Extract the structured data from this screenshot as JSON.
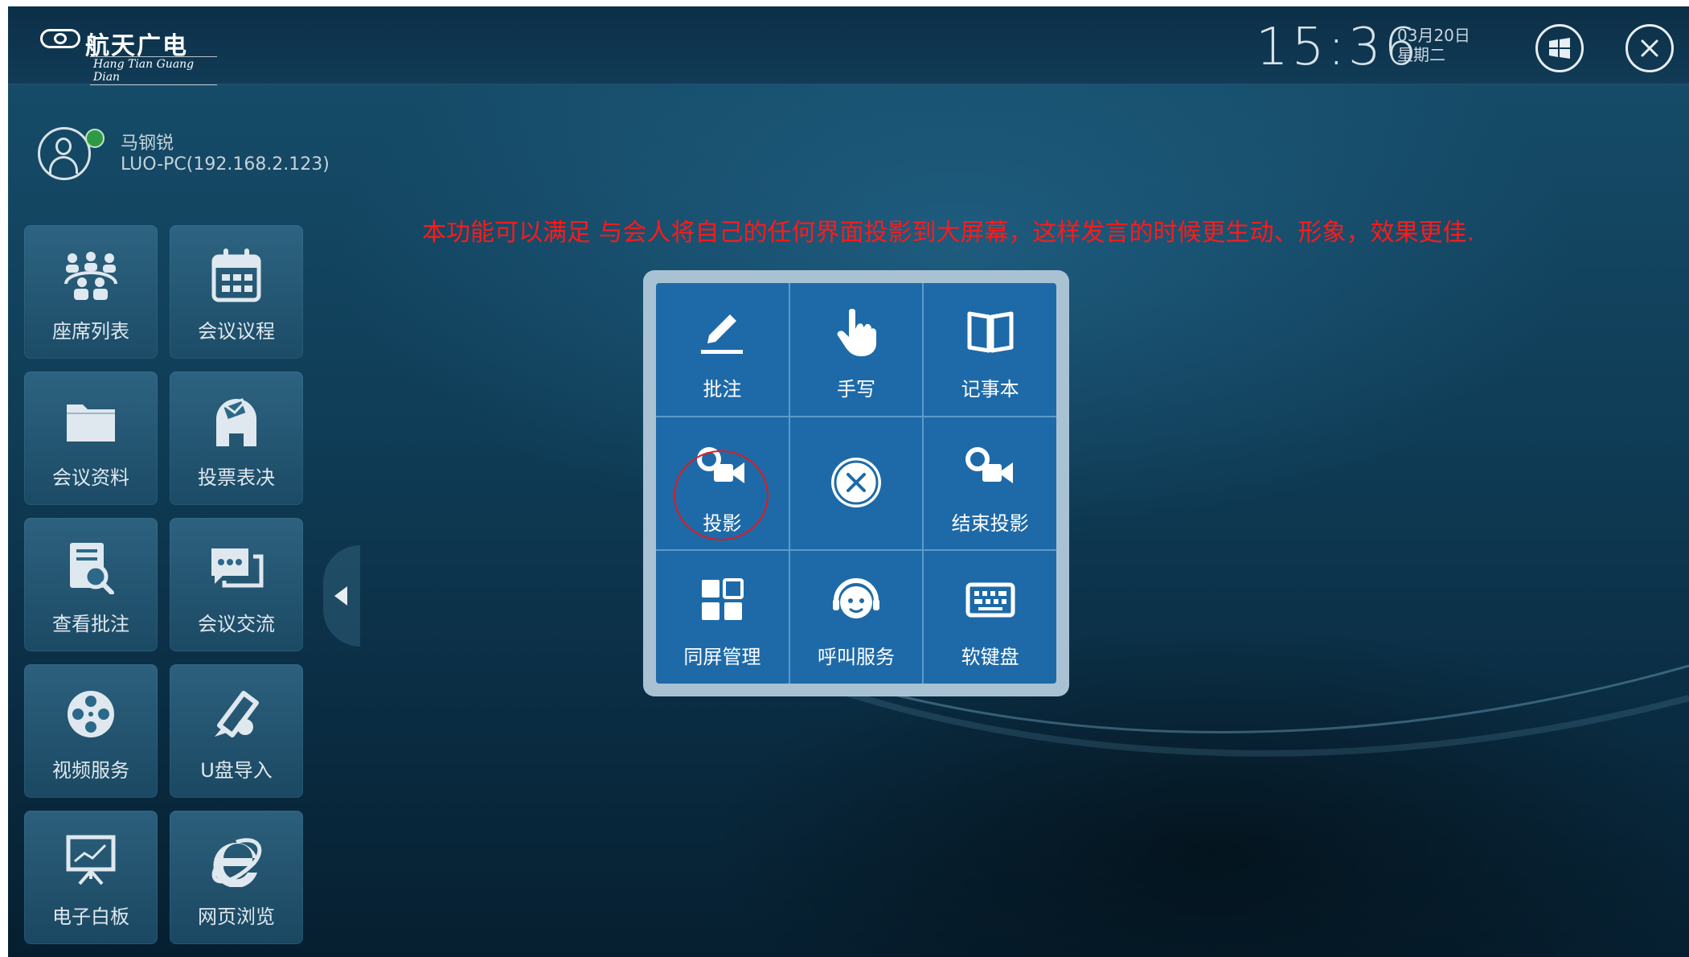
{
  "header": {
    "brand": "航天广电",
    "brand_sub": "Hang Tian Guang Dian",
    "time": "15:36",
    "date": "03月20日",
    "weekday": "星期二"
  },
  "user": {
    "name": "马钢锐",
    "host": "LUO-PC(192.168.2.123)"
  },
  "annotation": "本功能可以满足 与会人将自己的任何界面投影到大屏幕，这样发言的时候更生动、形象，效果更佳.",
  "sidebar": {
    "items": [
      {
        "label": "座席列表",
        "icon": "seat-list-icon"
      },
      {
        "label": "会议议程",
        "icon": "calendar-icon"
      },
      {
        "label": "会议资料",
        "icon": "folder-icon"
      },
      {
        "label": "投票表决",
        "icon": "vote-icon"
      },
      {
        "label": "查看批注",
        "icon": "view-annotation-icon"
      },
      {
        "label": "会议交流",
        "icon": "chat-icon"
      },
      {
        "label": "视频服务",
        "icon": "film-reel-icon"
      },
      {
        "label": "U盘导入",
        "icon": "usb-import-icon"
      },
      {
        "label": "电子白板",
        "icon": "whiteboard-icon"
      },
      {
        "label": "网页浏览",
        "icon": "ie-icon"
      }
    ]
  },
  "popup": {
    "items": [
      {
        "label": "批注",
        "icon": "pen-icon"
      },
      {
        "label": "手写",
        "icon": "hand-pointer-icon"
      },
      {
        "label": "记事本",
        "icon": "book-icon"
      },
      {
        "label": "投影",
        "icon": "camera-icon"
      },
      {
        "label": "",
        "icon": "close-circle-icon"
      },
      {
        "label": "结束投影",
        "icon": "camera-icon"
      },
      {
        "label": "同屏管理",
        "icon": "tiles-icon"
      },
      {
        "label": "呼叫服务",
        "icon": "service-face-icon"
      },
      {
        "label": "软键盘",
        "icon": "keyboard-icon"
      }
    ]
  },
  "colors": {
    "annotation": "#ff1a1a",
    "popup_cell": "#1e6aa8",
    "popup_frame": "#a9c2d3",
    "online": "#2f9a45"
  }
}
